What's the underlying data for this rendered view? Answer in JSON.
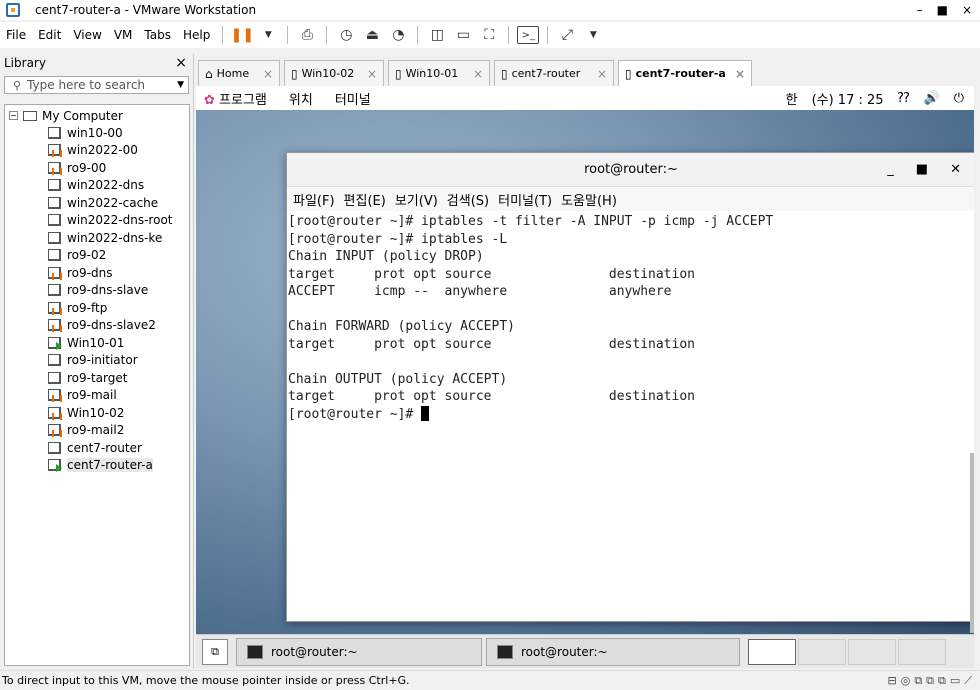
{
  "window": {
    "title": "cent7-router-a - VMware Workstation",
    "minimize": "–",
    "maximize": "■",
    "close": "×"
  },
  "menubar": {
    "items": [
      "File",
      "Edit",
      "View",
      "VM",
      "Tabs",
      "Help"
    ]
  },
  "library": {
    "title": "Library",
    "close": "×",
    "search_placeholder": "Type here to search",
    "root": "My Computer",
    "items": [
      {
        "label": "win10-00",
        "state": "off"
      },
      {
        "label": "win2022-00",
        "state": "suspended"
      },
      {
        "label": "ro9-00",
        "state": "suspended"
      },
      {
        "label": "win2022-dns",
        "state": "off"
      },
      {
        "label": "win2022-cache",
        "state": "off"
      },
      {
        "label": "win2022-dns-root",
        "state": "off"
      },
      {
        "label": "win2022-dns-ke",
        "state": "off"
      },
      {
        "label": "ro9-02",
        "state": "off"
      },
      {
        "label": "ro9-dns",
        "state": "suspended"
      },
      {
        "label": "ro9-dns-slave",
        "state": "off"
      },
      {
        "label": "ro9-ftp",
        "state": "suspended"
      },
      {
        "label": "ro9-dns-slave2",
        "state": "suspended"
      },
      {
        "label": "Win10-01",
        "state": "running"
      },
      {
        "label": "ro9-initiator",
        "state": "off"
      },
      {
        "label": "ro9-target",
        "state": "off"
      },
      {
        "label": "ro9-mail",
        "state": "suspended"
      },
      {
        "label": "Win10-02",
        "state": "suspended"
      },
      {
        "label": "ro9-mail2",
        "state": "suspended"
      },
      {
        "label": "cent7-router",
        "state": "off"
      },
      {
        "label": "cent7-router-a",
        "state": "running"
      }
    ]
  },
  "tabs": [
    {
      "label": "Home",
      "icon": "⌂"
    },
    {
      "label": "Win10-02",
      "icon": "▯"
    },
    {
      "label": "Win10-01",
      "icon": "▯"
    },
    {
      "label": "cent7-router",
      "icon": "▯"
    },
    {
      "label": "cent7-router-a",
      "icon": "▯"
    }
  ],
  "gnome_bar": {
    "apps": "프로그램",
    "places": "위치",
    "terminal": "터미널",
    "ime": "한",
    "clock": "(수) 17 : 25"
  },
  "terminal": {
    "title": "root@router:~",
    "menu": [
      "파일(F)",
      "편집(E)",
      "보기(V)",
      "검색(S)",
      "터미널(T)",
      "도움말(H)"
    ],
    "lines": [
      "[root@router ~]# iptables -t filter -A INPUT -p icmp -j ACCEPT",
      "[root@router ~]# iptables -L",
      "Chain INPUT (policy DROP)",
      "target     prot opt source               destination",
      "ACCEPT     icmp --  anywhere             anywhere",
      "",
      "Chain FORWARD (policy ACCEPT)",
      "target     prot opt source               destination",
      "",
      "Chain OUTPUT (policy ACCEPT)",
      "target     prot opt source               destination"
    ],
    "prompt": "[root@router ~]# "
  },
  "taskbar": {
    "items": [
      "root@router:~",
      "root@router:~"
    ]
  },
  "statusbar": {
    "text": "To direct input to this VM, move the mouse pointer inside or press Ctrl+G."
  }
}
